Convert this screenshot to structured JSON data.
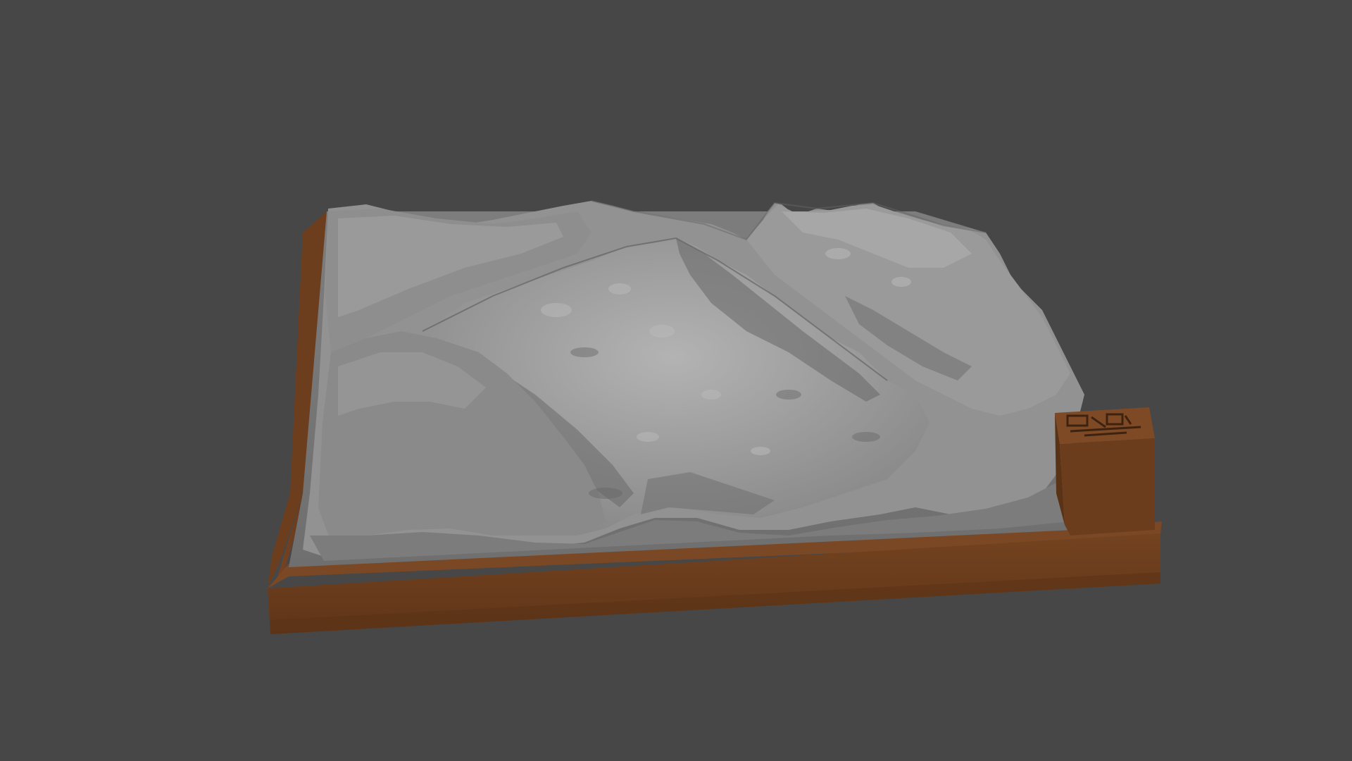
{
  "viewport": {
    "background_color": "#474747"
  },
  "model": {
    "kind": "3D printed terrain relief model on a base",
    "terrain_color": "#8c8c8c",
    "terrain_highlight_color": "#a9a9a9",
    "terrain_shadow_color": "#5e5e5e",
    "base_color": "#6b3d1e",
    "base_dark_color": "#4e2b14",
    "base_light_color": "#7a4725",
    "tag_block": {
      "kind": "embossed label block",
      "icon": "engraved-emblem"
    }
  }
}
